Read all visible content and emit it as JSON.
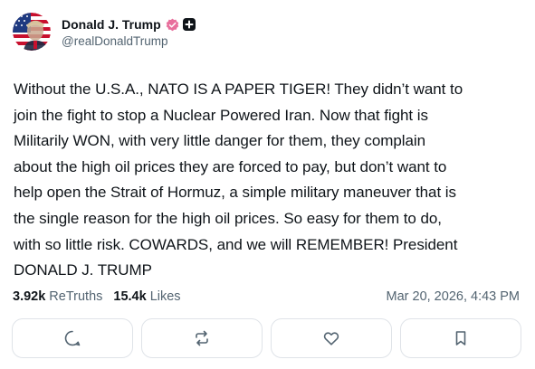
{
  "author": {
    "display_name": "Donald J. Trump",
    "handle": "@realDonaldTrump",
    "avatar_icon": "flag-portrait-avatar",
    "verified_icon": "verified-badge-icon",
    "verified_color": "#e86f9c",
    "plus_icon": "plus-badge-icon"
  },
  "post": {
    "text": "Without the U.S.A., NATO IS A PAPER TIGER! They didn’t want to\njoin the fight to stop a Nuclear Powered Iran. Now that fight is\nMilitarily WON, with very little danger for them, they complain\nabout the high oil prices they are forced to pay, but don’t want to\nhelp open the Strait of Hormuz, a simple military maneuver that is\nthe single reason for the high oil prices. So easy for them to do,\nwith so little risk. COWARDS, and we will REMEMBER! President\nDONALD J. TRUMP"
  },
  "stats": {
    "retruths_count": "3.92k",
    "retruths_label": "ReTruths",
    "likes_count": "15.4k",
    "likes_label": "Likes",
    "timestamp": "Mar 20, 2026, 4:43 PM"
  },
  "actions": [
    {
      "icon": "reply-icon"
    },
    {
      "icon": "retruth-icon"
    },
    {
      "icon": "like-icon"
    },
    {
      "icon": "bookmark-icon"
    }
  ],
  "colors": {
    "text": "#0f1419",
    "muted": "#536471",
    "border": "#dfe3e8"
  }
}
